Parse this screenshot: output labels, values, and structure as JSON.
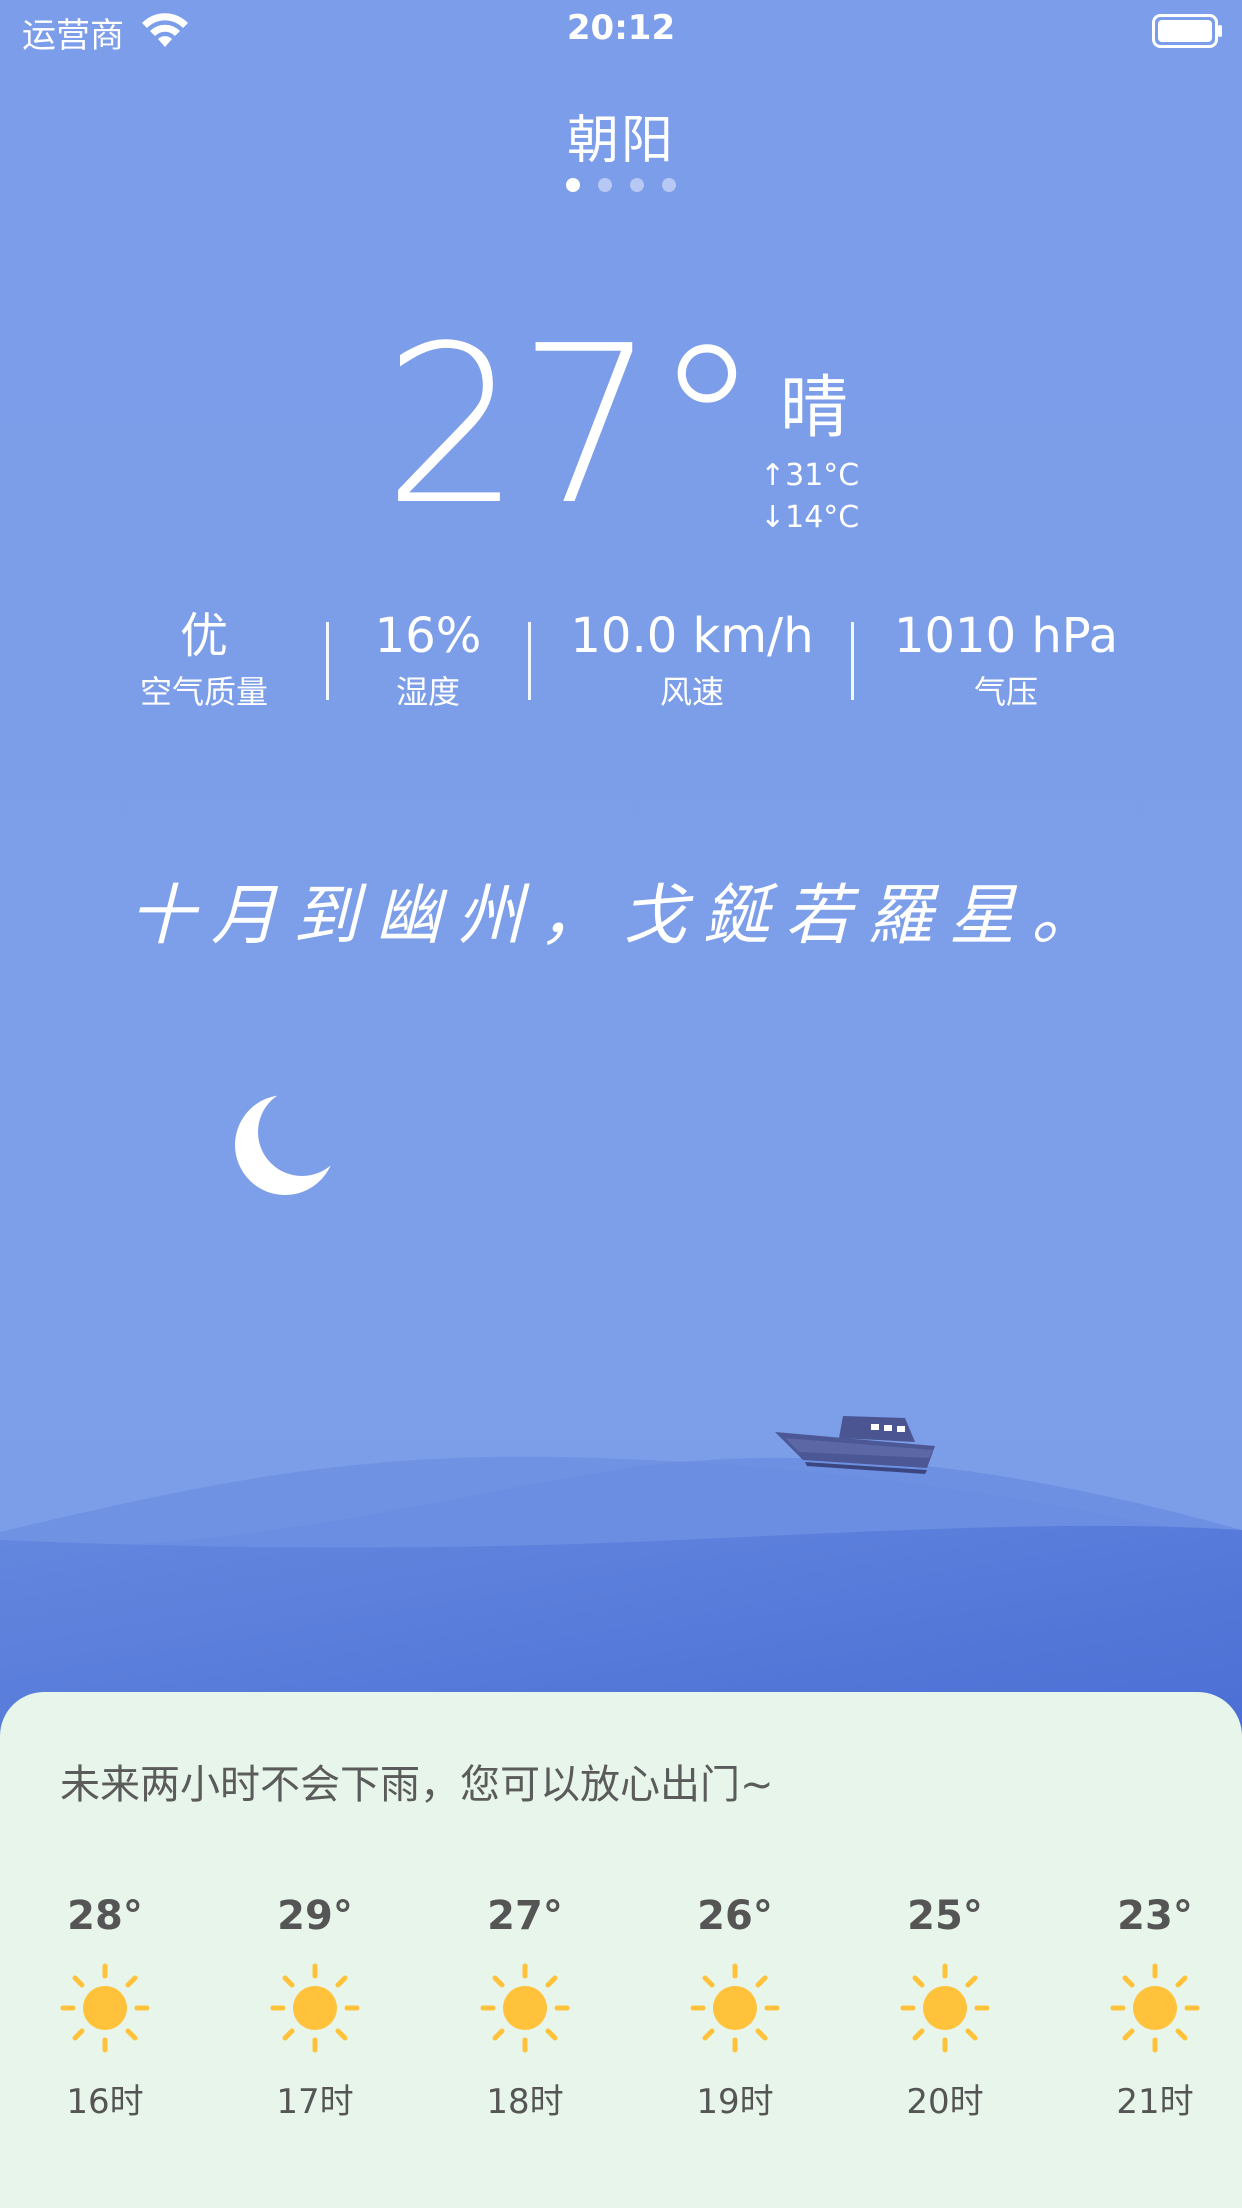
{
  "status_bar": {
    "carrier": "运营商",
    "time": "20:12"
  },
  "header": {
    "city": "朝阳",
    "page_count": 4,
    "active_page": 1
  },
  "current": {
    "temperature": "27°",
    "condition": "晴",
    "high": "↑31°C",
    "low": "↓14°C"
  },
  "stats": [
    {
      "value": "优",
      "label": "空气质量"
    },
    {
      "value": "16%",
      "label": "湿度"
    },
    {
      "value": "10.0 km/h",
      "label": "风速"
    },
    {
      "value": "1010 hPa",
      "label": "气压"
    }
  ],
  "poem": "十月到幽州，戈鋋若羅星。",
  "forecast": {
    "notice": "未来两小时不会下雨，您可以放心出门~",
    "hours": [
      {
        "temp": "28°",
        "time": "16时",
        "icon": "sun-icon"
      },
      {
        "temp": "29°",
        "time": "17时",
        "icon": "sun-icon"
      },
      {
        "temp": "27°",
        "time": "18时",
        "icon": "sun-icon"
      },
      {
        "temp": "26°",
        "time": "19时",
        "icon": "sun-icon"
      },
      {
        "temp": "25°",
        "time": "20时",
        "icon": "sun-icon"
      },
      {
        "temp": "23°",
        "time": "21时",
        "icon": "sun-icon"
      }
    ]
  },
  "colors": {
    "sky": "#7c9de9",
    "sea": "#4f73d6",
    "panel": "#e8f5ea",
    "sun": "#ffc23a"
  }
}
